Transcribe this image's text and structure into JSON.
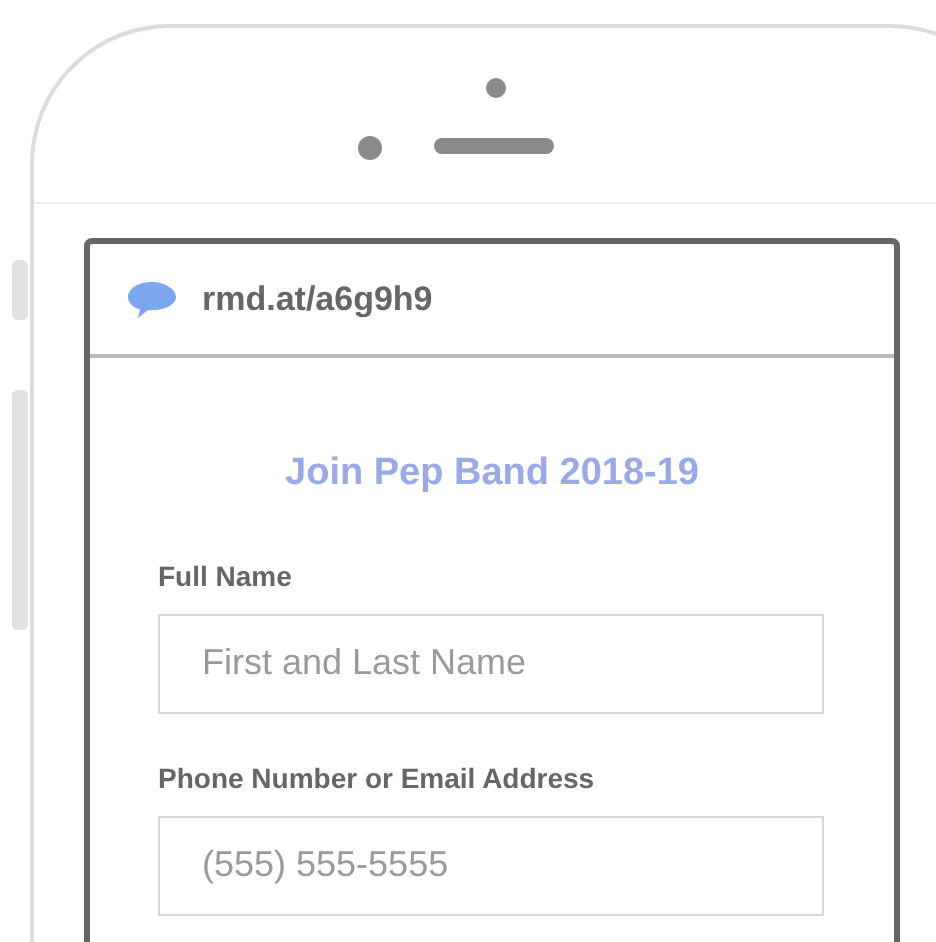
{
  "browser": {
    "url": "rmd.at/a6g9h9"
  },
  "form": {
    "title": "Join Pep Band 2018-19",
    "fields": [
      {
        "label": "Full Name",
        "placeholder": "First and Last Name"
      },
      {
        "label": "Phone Number or Email Address",
        "placeholder": "(555) 555-5555"
      }
    ]
  }
}
